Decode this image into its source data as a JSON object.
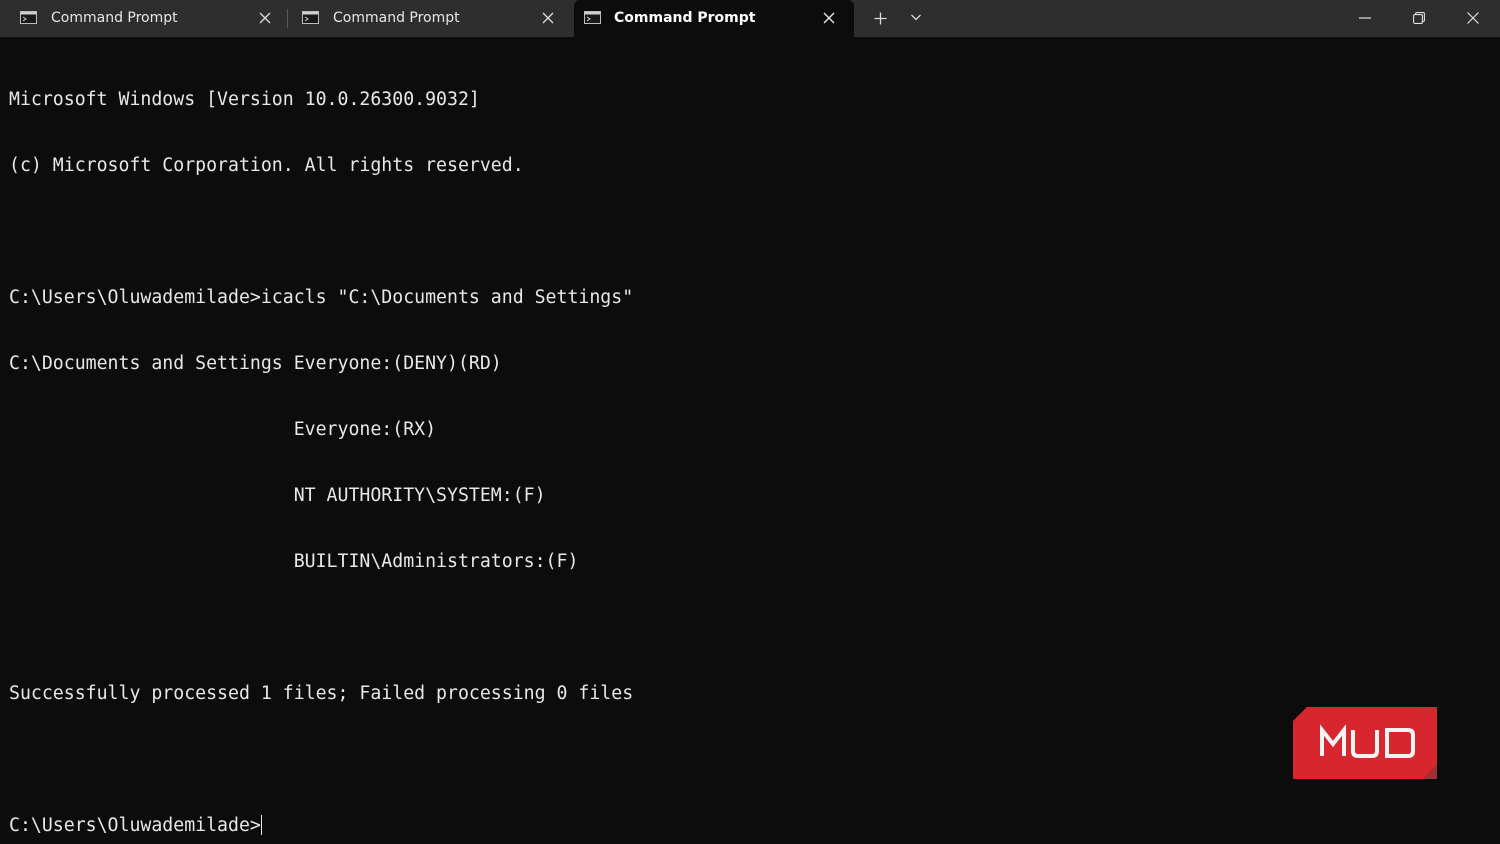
{
  "tabs": [
    {
      "label": "Command Prompt",
      "active": false
    },
    {
      "label": "Command Prompt",
      "active": false
    },
    {
      "label": "Command Prompt",
      "active": true
    }
  ],
  "terminal": {
    "lines": [
      "Microsoft Windows [Version 10.0.26300.9032]",
      "(c) Microsoft Corporation. All rights reserved.",
      "",
      "C:\\Users\\Oluwademilade>icacls \"C:\\Documents and Settings\"",
      "C:\\Documents and Settings Everyone:(DENY)(RD)",
      "                          Everyone:(RX)",
      "                          NT AUTHORITY\\SYSTEM:(F)",
      "                          BUILTIN\\Administrators:(F)",
      "",
      "Successfully processed 1 files; Failed processing 0 files",
      "",
      "C:\\Users\\Oluwademilade>"
    ]
  },
  "watermark": {
    "text": "MUO"
  },
  "colors": {
    "tabbar_bg": "#2e2e2e",
    "terminal_bg": "#0c0c0c",
    "terminal_fg": "#e8e8e8",
    "brand_red": "#d7262d"
  }
}
